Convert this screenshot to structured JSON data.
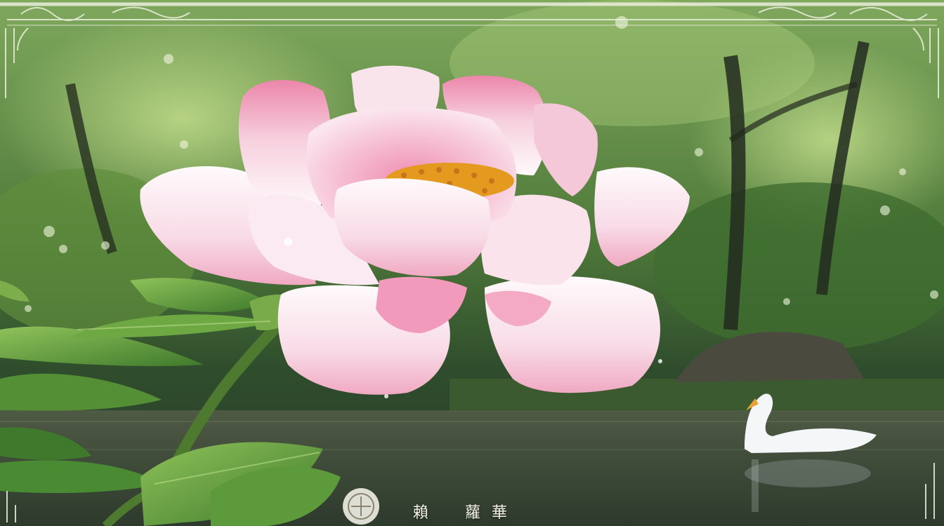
{
  "image": {
    "palette": {
      "foliage": "#4f7a3a",
      "foliage_light": "#9cc26c",
      "water": "#3e4a3a",
      "petal_white": "#fbf3f6",
      "petal_pink": "#f2a7c2",
      "petal_deep": "#e8739b",
      "stamen": "#e39a1f",
      "leaf": "#5f9a3a",
      "swan": "#f4f6f8",
      "frame_ornament": "#e9ead9"
    },
    "caption": {
      "char_1": "賴",
      "char_2": "蘿",
      "char_3": "華"
    }
  }
}
